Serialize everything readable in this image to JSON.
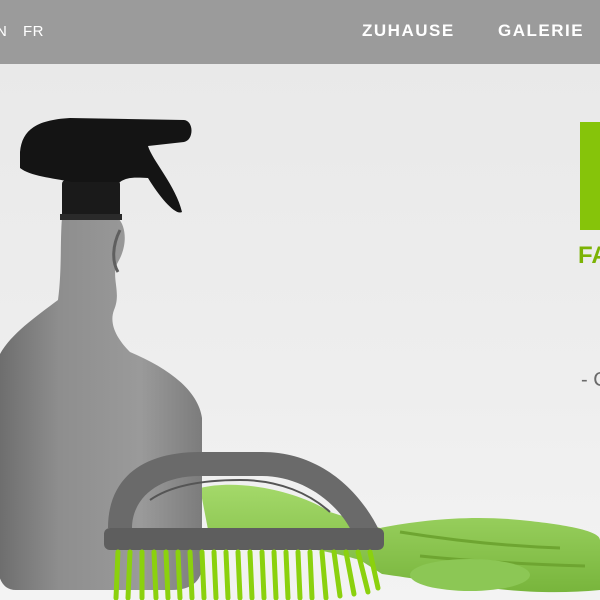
{
  "header": {
    "languages": [
      {
        "label": "N"
      },
      {
        "label": "FR"
      }
    ],
    "nav": [
      {
        "label": "ZUHAUSE"
      },
      {
        "label": "GALERIE"
      }
    ]
  },
  "hero": {
    "headline_fragment": "FA",
    "tagline_fragment": "- C",
    "colors": {
      "brand_green": "#86c40a",
      "header_gray": "#9b9b9b"
    },
    "image_subject": "spray bottle, scrub brush and green rubber gloves"
  }
}
